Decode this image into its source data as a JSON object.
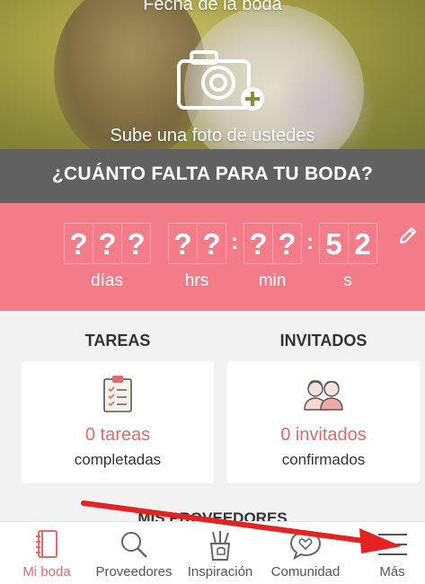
{
  "hero": {
    "title": "Fecha de la boda",
    "caption": "Sube una foto de ustedes"
  },
  "countdown": {
    "header": "¿CUÁNTO FALTA PARA TU BODA?",
    "days": [
      "?",
      "?",
      "?"
    ],
    "hours": [
      "?",
      "?"
    ],
    "minutes": [
      "?",
      "?"
    ],
    "seconds": [
      "5",
      "2"
    ],
    "labels": {
      "days": "días",
      "hours": "hrs",
      "minutes": "min",
      "seconds": "s"
    },
    "separator": ":"
  },
  "tasks": {
    "title": "TAREAS",
    "count": "0 tareas",
    "status": "completadas"
  },
  "guests": {
    "title": "INVITADOS",
    "count": "0 invitados",
    "status": "confirmados"
  },
  "vendors_peek": "MIS PROVEEDORES",
  "nav": [
    {
      "label": "Mi boda",
      "icon": "notebook-icon",
      "active": true
    },
    {
      "label": "Proveedores",
      "icon": "search-icon",
      "active": false
    },
    {
      "label": "Inspiración",
      "icon": "brushes-icon",
      "active": false
    },
    {
      "label": "Comunidad",
      "icon": "chat-heart-icon",
      "active": false
    },
    {
      "label": "Más",
      "icon": "menu-icon",
      "active": false
    }
  ],
  "colors": {
    "accent": "#f47c88",
    "accent_text": "#e16a6f",
    "header": "#616161",
    "arrow": "#e32222"
  }
}
